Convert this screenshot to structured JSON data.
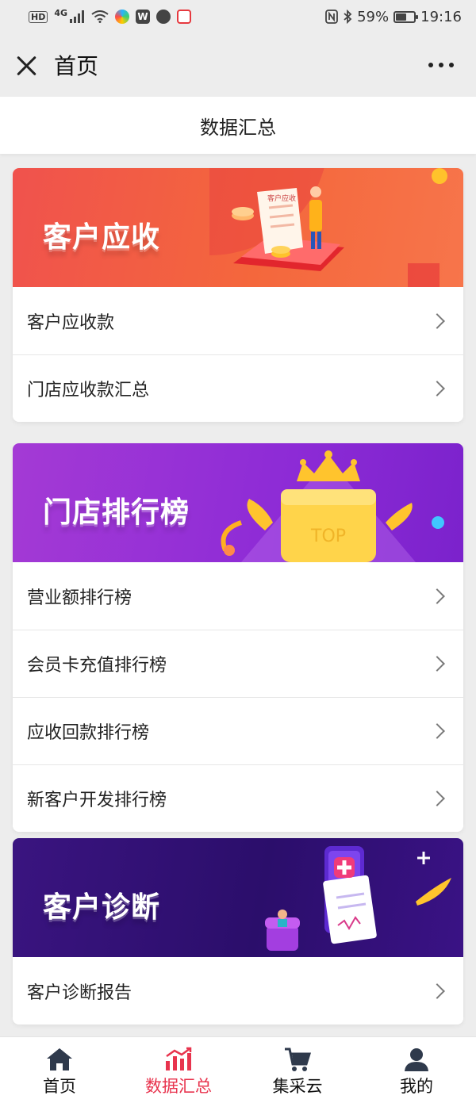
{
  "status_bar": {
    "left_tags": [
      "HD",
      "4G"
    ],
    "battery": "59%",
    "battery_level": 0.59,
    "time": "19:16"
  },
  "navbar": {
    "title": "首页",
    "close_icon": "close-icon",
    "more_icon": "more-icon"
  },
  "page": {
    "title": "数据汇总"
  },
  "sections": [
    {
      "banner_title": "客户应收",
      "banner_sign": "客户应收",
      "theme": "#f0524d",
      "items": [
        {
          "label": "客户应收款"
        },
        {
          "label": "门店应收款汇总"
        }
      ]
    },
    {
      "banner_title": "门店排行榜",
      "banner_sign": "TOP",
      "theme": "#9a34d6",
      "items": [
        {
          "label": "营业额排行榜"
        },
        {
          "label": "会员卡充值排行榜"
        },
        {
          "label": "应收回款排行榜"
        },
        {
          "label": "新客户开发排行榜"
        }
      ]
    },
    {
      "banner_title": "客户诊断",
      "theme": "#2f0f72",
      "items": [
        {
          "label": "客户诊断报告"
        }
      ]
    }
  ],
  "tabbar": {
    "active_color": "#e8344e",
    "tabs": [
      {
        "label": "首页",
        "icon": "home-icon",
        "active": false
      },
      {
        "label": "数据汇总",
        "icon": "bar-chart-icon",
        "active": true
      },
      {
        "label": "集采云",
        "icon": "cart-icon",
        "active": false
      },
      {
        "label": "我的",
        "icon": "user-icon",
        "active": false
      }
    ]
  }
}
